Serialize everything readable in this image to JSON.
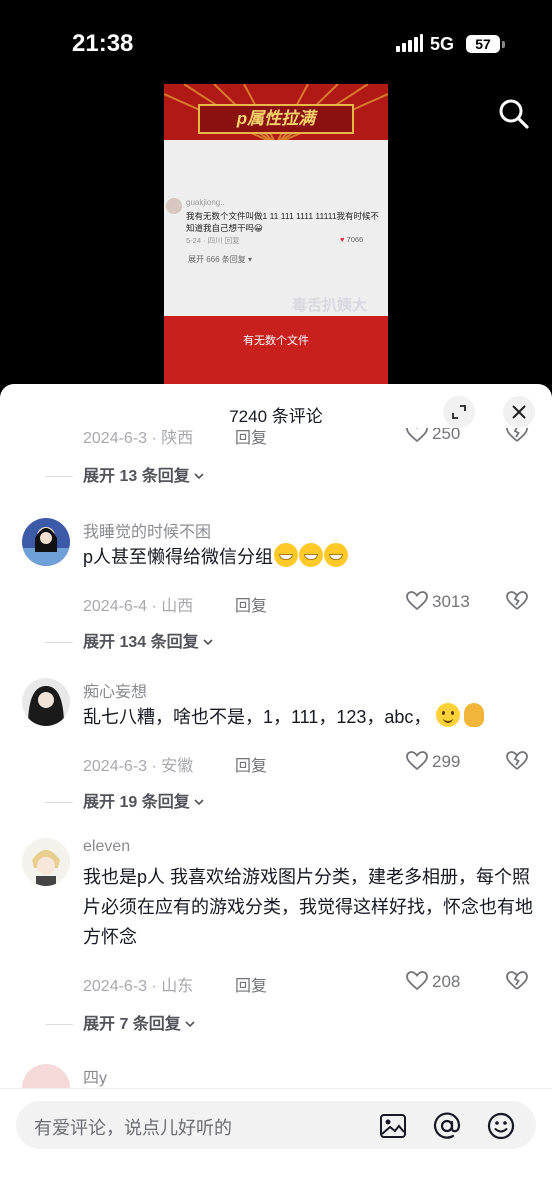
{
  "status_bar": {
    "time": "21:38",
    "network": "5G",
    "battery": "57"
  },
  "video": {
    "banner_title": "p属性拉满",
    "mini_comment": {
      "user": "guakjiong..",
      "text": "我有无数个文件叫做1 11 111 1111 11111我有时候不知道我自己想干吗😀",
      "meta": "5-24 · 四川      回复",
      "likes": "7066",
      "expand": "展开 666 条回复 ▾"
    },
    "watermark": "毒舌扒姨大",
    "caption": "有无数个文件"
  },
  "comments_sheet": {
    "title": "7240 条评论",
    "partial_top": {
      "date": "2024-6-3 · 陕西",
      "reply": "回复",
      "likes": "250",
      "expand": "展开 13 条回复"
    },
    "comments": [
      {
        "user": "我睡觉的时候不困",
        "text": "p人甚至懒得给微信分组",
        "date": "2024-6-4 · 山西",
        "reply": "回复",
        "likes": "3013",
        "expand": "展开 134 条回复"
      },
      {
        "user": "痴心妄想",
        "text": "乱七八糟，啥也不是，1，111，123，abc，",
        "date": "2024-6-3 · 安徽",
        "reply": "回复",
        "likes": "299",
        "expand": "展开 19 条回复"
      },
      {
        "user": "eleven",
        "text": "我也是p人 我喜欢给游戏图片分类，建老多相册，每个照片必须在应有的游戏分类，我觉得这样好找，怀念也有地方怀念",
        "date": "2024-6-3 · 山东",
        "reply": "回复",
        "likes": "208",
        "expand": "展开 7 条回复"
      },
      {
        "user": "四y"
      }
    ]
  },
  "input_bar": {
    "placeholder": "有爱评论，说点儿好听的"
  },
  "colors": {
    "accent_red": "#c8201d",
    "banner_gold": "#f8d26a",
    "text_primary": "#161823",
    "text_secondary": "#8a8b91"
  },
  "icons": [
    "search-icon",
    "expand-icon",
    "close-icon",
    "heart-icon",
    "broken-heart-icon",
    "chevron-down-icon",
    "image-icon",
    "at-icon",
    "emoji-icon"
  ]
}
